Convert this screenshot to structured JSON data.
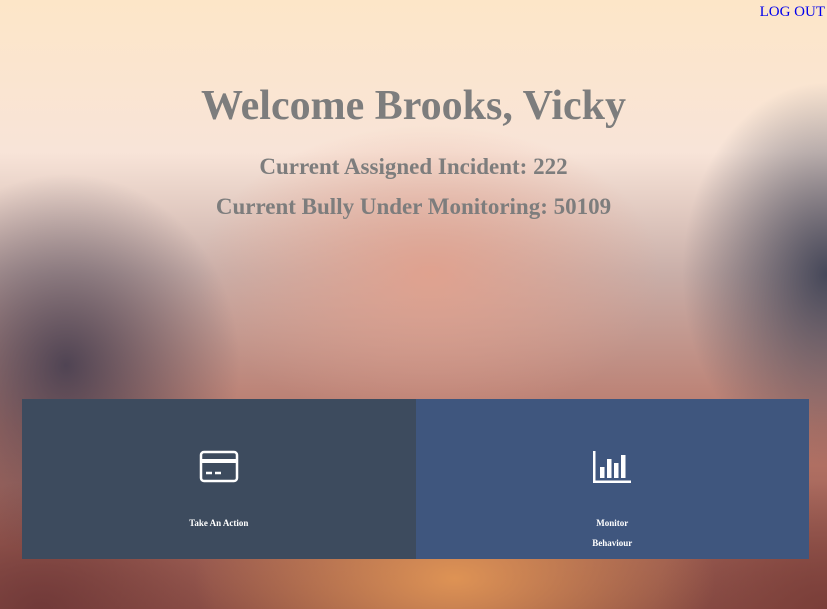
{
  "header": {
    "logout_label": "LOG OUT"
  },
  "welcome": {
    "title": "Welcome Brooks, Vicky",
    "assigned_incident": "Current Assigned Incident: 222",
    "bully_monitoring": "Current Bully Under Monitoring: 50109"
  },
  "actions": [
    {
      "label": "Take An Action",
      "icon": "credit-card-icon"
    },
    {
      "label": "Monitor Behaviour",
      "icon": "bar-chart-icon"
    }
  ],
  "colors": {
    "link": "#0000ee",
    "heading_text": "#7d7d7d",
    "tile_action_bg": "#3d4b5e",
    "tile_monitor_bg": "#3f567e"
  }
}
